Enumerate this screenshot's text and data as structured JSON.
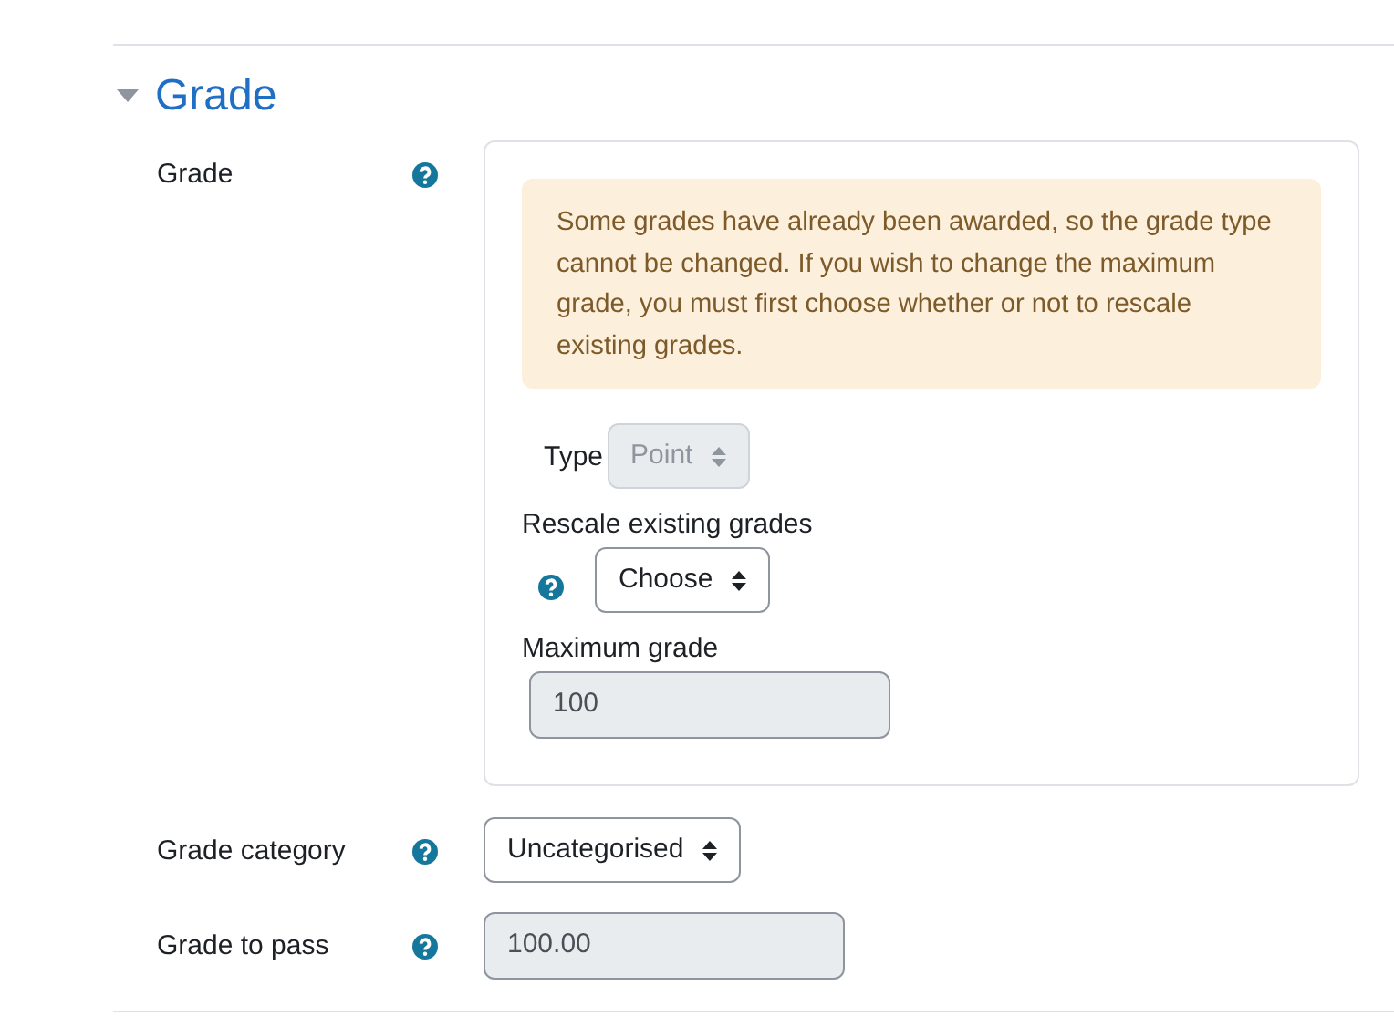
{
  "section": {
    "title": "Grade",
    "expanded": true
  },
  "grade_group": {
    "label": "Grade",
    "alert": "Some grades have already been awarded, so the grade type cannot be changed. If you wish to change the maximum grade, you must first choose whether or not to rescale existing grades.",
    "type": {
      "label": "Type",
      "value": "Point",
      "disabled": true
    },
    "rescale": {
      "label": "Rescale existing grades",
      "value": "Choose",
      "disabled": false
    },
    "maximum": {
      "label": "Maximum grade",
      "value": "100",
      "disabled": true
    }
  },
  "grade_category": {
    "label": "Grade category",
    "value": "Uncategorised",
    "disabled": false
  },
  "grade_to_pass": {
    "label": "Grade to pass",
    "value": "100.00",
    "disabled": true
  }
}
